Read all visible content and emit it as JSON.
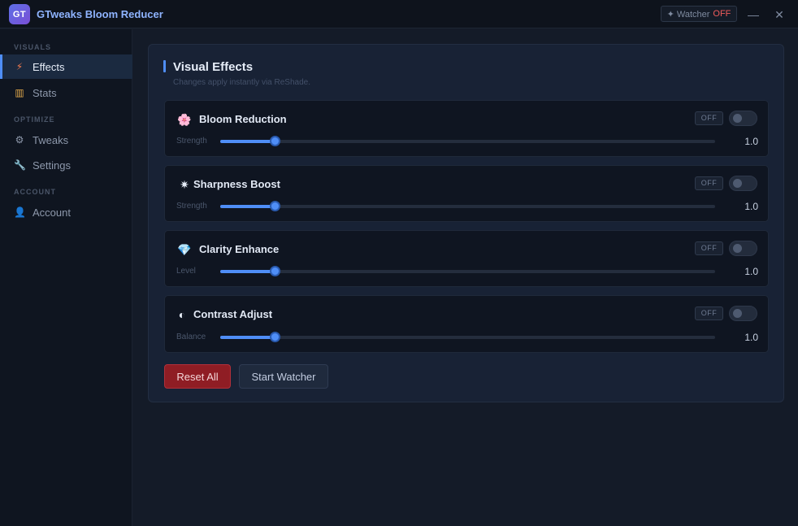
{
  "titlebar": {
    "logo_text": "GT",
    "title": "GTweaks Bloom Reducer",
    "watcher_label": "✦ Watcher",
    "watcher_state": "OFF",
    "minimize_glyph": "—",
    "close_glyph": "✕"
  },
  "sidebar": {
    "sections": [
      {
        "label": "VISUALS"
      },
      {
        "label": "OPTIMIZE"
      },
      {
        "label": "ACCOUNT"
      }
    ],
    "items": [
      {
        "label": "Effects",
        "icon": "lightning-icon",
        "glyph": "⚡",
        "active": true
      },
      {
        "label": "Stats",
        "icon": "bar-chart-icon",
        "glyph": "▥",
        "active": false
      },
      {
        "label": "Tweaks",
        "icon": "gear-icon",
        "glyph": "⚙",
        "active": false
      },
      {
        "label": "Settings",
        "icon": "wrench-icon",
        "glyph": "🔧",
        "active": false
      },
      {
        "label": "Account",
        "icon": "user-icon",
        "glyph": "👤",
        "active": false
      }
    ]
  },
  "panel": {
    "title": "Visual Effects",
    "subtitle": "Changes apply instantly via ReShade.",
    "effects": [
      {
        "name": "Bloom Reduction",
        "icon": "flower-icon",
        "glyph": "🌸",
        "state": "OFF",
        "slider_label": "Strength",
        "value": "1.0",
        "level": 0.11
      },
      {
        "name": "Sharpness Boost",
        "icon": "sparkle-icon",
        "glyph": "✷",
        "state": "OFF",
        "slider_label": "Strength",
        "value": "1.0",
        "level": 0.11
      },
      {
        "name": "Clarity Enhance",
        "icon": "diamond-icon",
        "glyph": "💎",
        "state": "OFF",
        "slider_label": "Level",
        "value": "1.0",
        "level": 0.11
      },
      {
        "name": "Contrast Adjust",
        "icon": "contrast-icon",
        "glyph": "◐",
        "state": "OFF",
        "slider_label": "Balance",
        "value": "1.0",
        "level": 0.11
      }
    ],
    "reset_label": "Reset All",
    "watcher_button_label": "Start Watcher"
  },
  "colors": {
    "accent": "#4f8ef7",
    "danger": "#8f1d24",
    "off_text": "#ef5b5b",
    "background": "#141b28"
  }
}
